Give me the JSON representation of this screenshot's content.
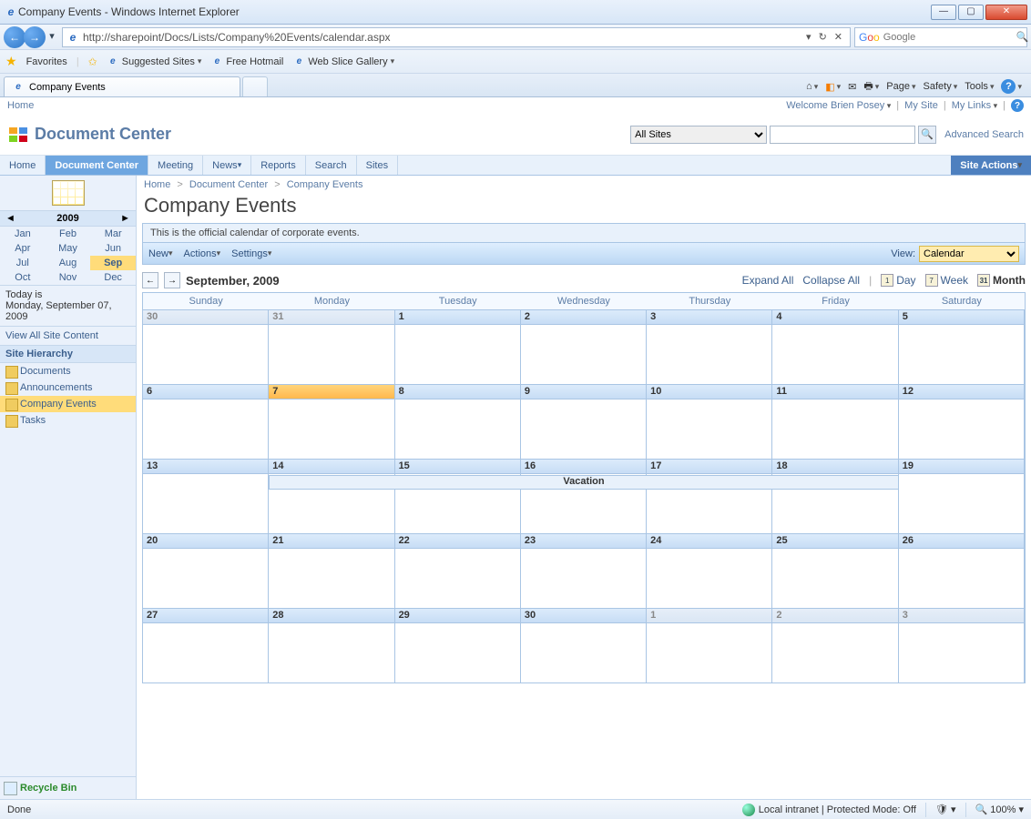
{
  "window": {
    "title": "Company Events - Windows Internet Explorer"
  },
  "address": {
    "url": "http://sharepoint/Docs/Lists/Company%20Events/calendar.aspx"
  },
  "search_engine": {
    "placeholder": "Google"
  },
  "fav_bar": {
    "favorites": "Favorites",
    "suggested": "Suggested Sites",
    "hotmail": "Free Hotmail",
    "webslice": "Web Slice Gallery"
  },
  "tab": {
    "label": "Company Events"
  },
  "cmdbar": {
    "page": "Page",
    "safety": "Safety",
    "tools": "Tools"
  },
  "global": {
    "home": "Home",
    "welcome": "Welcome Brien Posey",
    "mysite": "My Site",
    "mylinks": "My Links"
  },
  "header": {
    "site_title": "Document Center",
    "scope": "All Sites",
    "adv": "Advanced Search"
  },
  "topnav": {
    "tabs": [
      "Home",
      "Document Center",
      "Meeting",
      "News",
      "Reports",
      "Search",
      "Sites"
    ],
    "active": 1,
    "site_actions": "Site Actions"
  },
  "sidebar": {
    "year": "2009",
    "months": [
      "Jan",
      "Feb",
      "Mar",
      "Apr",
      "May",
      "Jun",
      "Jul",
      "Aug",
      "Sep",
      "Oct",
      "Nov",
      "Dec"
    ],
    "sel_month": 8,
    "today_label": "Today is",
    "today_date": "Monday, September 07, 2009",
    "view_all": "View All Site Content",
    "hierarchy": "Site Hierarchy",
    "items": [
      "Documents",
      "Announcements",
      "Company Events",
      "Tasks"
    ],
    "sel_item": 2,
    "recycle": "Recycle Bin"
  },
  "breadcrumb": {
    "p1": "Home",
    "p2": "Document Center",
    "p3": "Company Events"
  },
  "page": {
    "title": "Company Events",
    "desc": "This is the official calendar of corporate events."
  },
  "toolbar": {
    "new": "New",
    "actions": "Actions",
    "settings": "Settings",
    "view_label": "View:",
    "view_value": "Calendar"
  },
  "calendar": {
    "month_label": "September, 2009",
    "expand": "Expand All",
    "collapse": "Collapse All",
    "day": "Day",
    "week": "Week",
    "month": "Month",
    "dow": [
      "Sunday",
      "Monday",
      "Tuesday",
      "Wednesday",
      "Thursday",
      "Friday",
      "Saturday"
    ],
    "weeks": [
      {
        "days": [
          {
            "n": "30",
            "other": true
          },
          {
            "n": "31",
            "other": true
          },
          {
            "n": "1"
          },
          {
            "n": "2"
          },
          {
            "n": "3"
          },
          {
            "n": "4"
          },
          {
            "n": "5"
          }
        ]
      },
      {
        "days": [
          {
            "n": "6"
          },
          {
            "n": "7",
            "today": true
          },
          {
            "n": "8"
          },
          {
            "n": "9"
          },
          {
            "n": "10"
          },
          {
            "n": "11"
          },
          {
            "n": "12"
          }
        ]
      },
      {
        "days": [
          {
            "n": "13"
          },
          {
            "n": "14"
          },
          {
            "n": "15"
          },
          {
            "n": "16"
          },
          {
            "n": "17"
          },
          {
            "n": "18"
          },
          {
            "n": "19"
          }
        ],
        "event": {
          "label": "Vacation",
          "start": 1,
          "span": 5
        }
      },
      {
        "days": [
          {
            "n": "20"
          },
          {
            "n": "21"
          },
          {
            "n": "22"
          },
          {
            "n": "23"
          },
          {
            "n": "24"
          },
          {
            "n": "25"
          },
          {
            "n": "26"
          }
        ]
      },
      {
        "days": [
          {
            "n": "27"
          },
          {
            "n": "28"
          },
          {
            "n": "29"
          },
          {
            "n": "30"
          },
          {
            "n": "1",
            "other": true
          },
          {
            "n": "2",
            "other": true
          },
          {
            "n": "3",
            "other": true
          }
        ]
      }
    ]
  },
  "status": {
    "done": "Done",
    "zone": "Local intranet | Protected Mode: Off",
    "zoom": "100%"
  }
}
